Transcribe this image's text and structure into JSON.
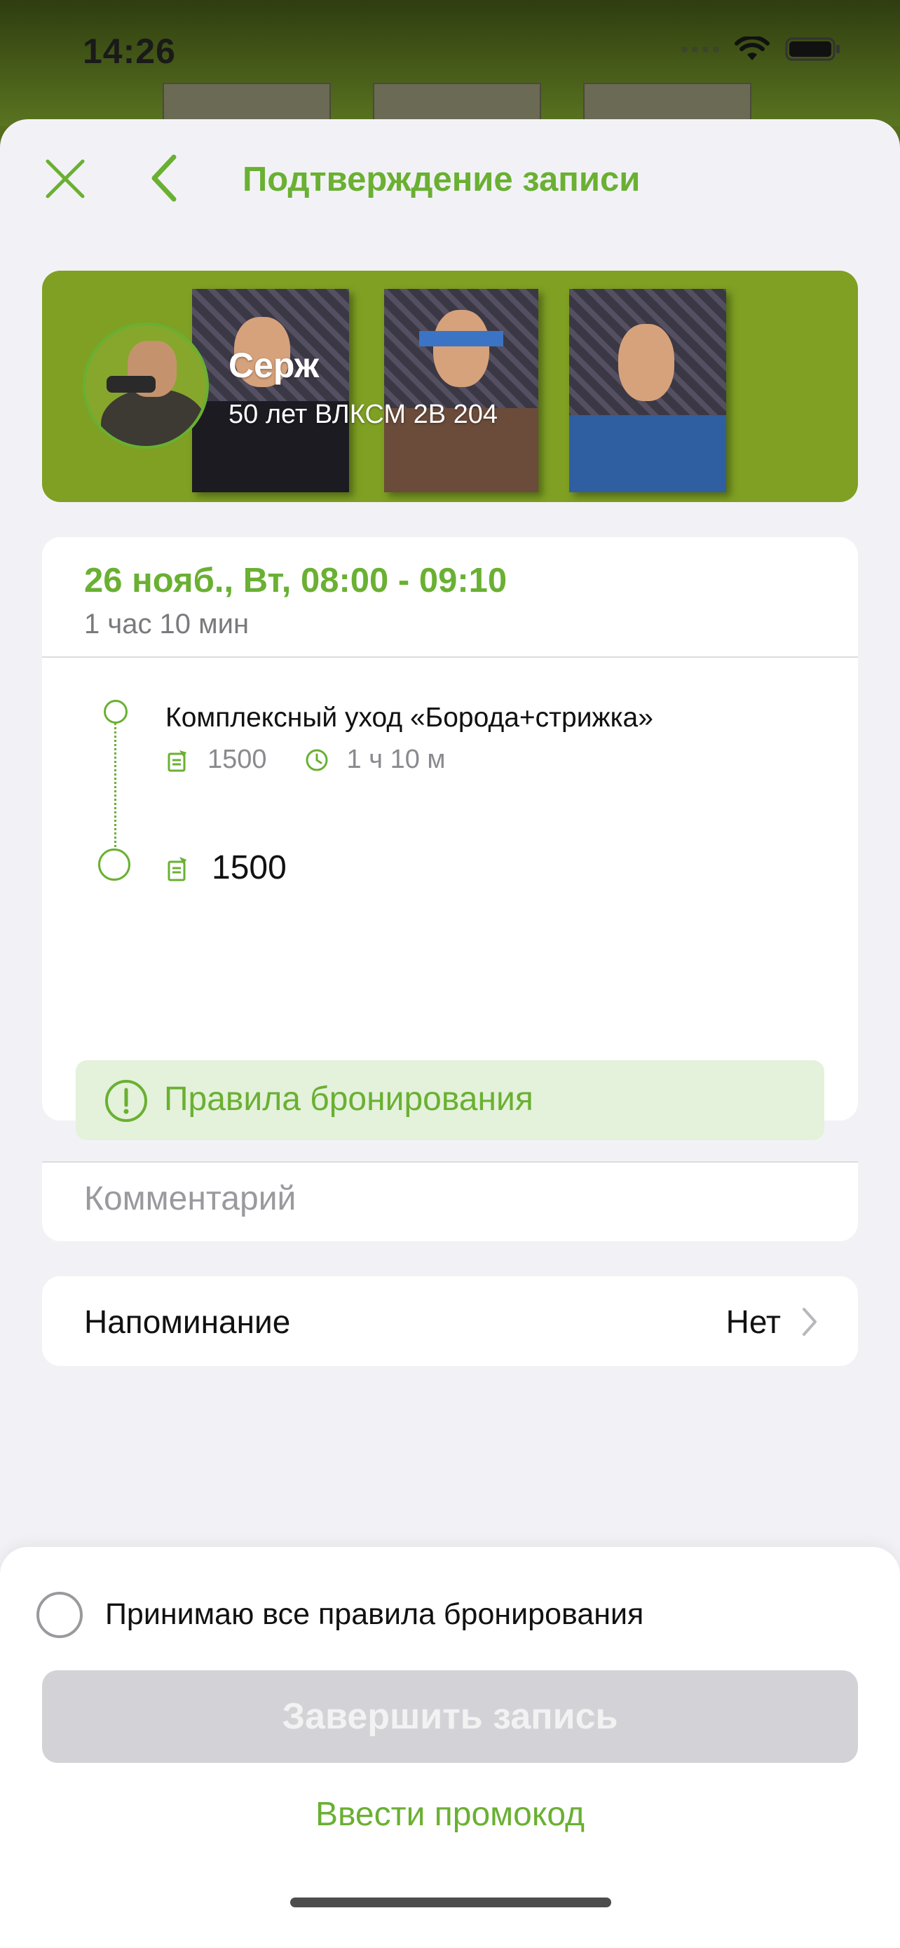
{
  "status_bar": {
    "time": "14:26"
  },
  "nav": {
    "title": "Подтверждение записи",
    "close_icon": "close-icon",
    "back_icon": "chevron-left-icon"
  },
  "master": {
    "name": "Серж",
    "address": "50 лет ВЛКСМ 2В 204"
  },
  "booking": {
    "date_time": "26 нояб., Вт, 08:00 - 09:10",
    "duration": "1 час 10 мин",
    "service": {
      "title": "Комплексный уход «Борода+стрижка»",
      "price": "1500",
      "duration": "1 ч 10 м"
    },
    "total": "1500",
    "rules_label": "Правила бронирования"
  },
  "comment": {
    "placeholder": "Комментарий"
  },
  "reminder": {
    "label": "Напоминание",
    "value": "Нет"
  },
  "footer": {
    "accept_label": "Принимаю все правила бронирования",
    "accept_checked": false,
    "finish_label": "Завершить запись",
    "finish_enabled": false,
    "promo_label": "Ввести промокод"
  },
  "colors": {
    "accent": "#6ab032",
    "rules_bg": "#e4f1db",
    "disabled_button": "#d3d3d7",
    "background": "#f2f2f6"
  }
}
